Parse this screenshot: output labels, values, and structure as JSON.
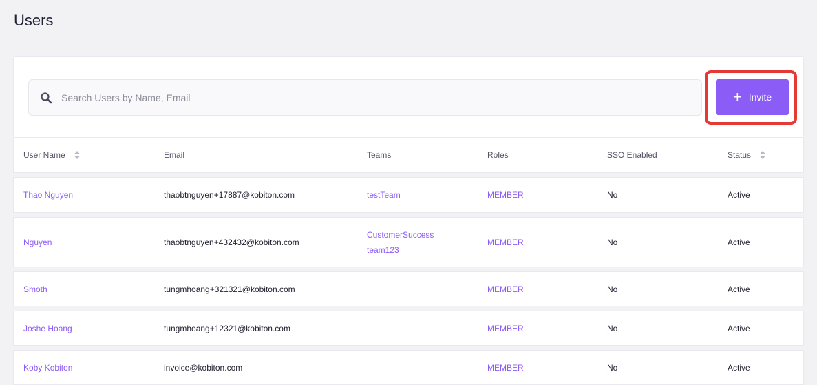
{
  "page": {
    "title": "Users"
  },
  "search": {
    "placeholder": "Search Users by Name, Email"
  },
  "invite": {
    "label": "Invite"
  },
  "table": {
    "headers": {
      "user_name": "User Name",
      "email": "Email",
      "teams": "Teams",
      "roles": "Roles",
      "sso": "SSO Enabled",
      "status": "Status"
    },
    "rows": [
      {
        "name": "Thao Nguyen",
        "email": "thaobtnguyen+17887@kobiton.com",
        "teams": [
          "testTeam"
        ],
        "role": "MEMBER",
        "sso": "No",
        "status": "Active"
      },
      {
        "name": "Nguyen",
        "email": "thaobtnguyen+432432@kobiton.com",
        "teams": [
          "CustomerSuccess",
          "team123"
        ],
        "role": "MEMBER",
        "sso": "No",
        "status": "Active"
      },
      {
        "name": "Smoth",
        "email": "tungmhoang+321321@kobiton.com",
        "teams": [],
        "role": "MEMBER",
        "sso": "No",
        "status": "Active"
      },
      {
        "name": "Joshe Hoang",
        "email": "tungmhoang+12321@kobiton.com",
        "teams": [],
        "role": "MEMBER",
        "sso": "No",
        "status": "Active"
      },
      {
        "name": "Koby Kobiton",
        "email": "invoice@kobiton.com",
        "teams": [],
        "role": "MEMBER",
        "sso": "No",
        "status": "Active"
      }
    ]
  },
  "colors": {
    "accent": "#8b5cf6",
    "highlight": "#e53935"
  }
}
